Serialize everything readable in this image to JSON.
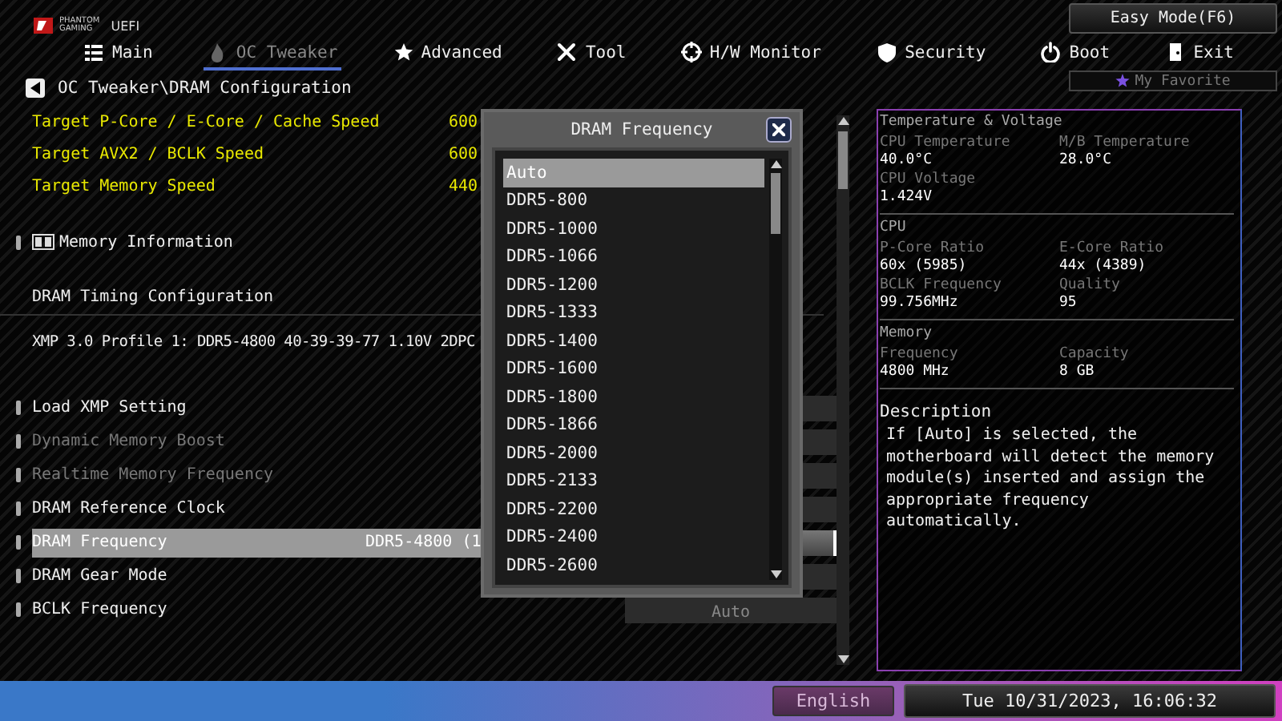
{
  "header": {
    "logo": {
      "lines": [
        "PHANTOM",
        "GAMING"
      ],
      "product": "UEFI"
    },
    "easy_mode_button": "Easy Mode(F6)",
    "tabs": [
      {
        "label": "Main",
        "selected": false
      },
      {
        "label": "OC Tweaker",
        "selected": true
      },
      {
        "label": "Advanced",
        "selected": false
      },
      {
        "label": "Tool",
        "selected": false
      },
      {
        "label": "H/W Monitor",
        "selected": false
      },
      {
        "label": "Security",
        "selected": false
      },
      {
        "label": "Boot",
        "selected": false
      },
      {
        "label": "Exit",
        "selected": false
      }
    ],
    "favorite_button": "My Favorite"
  },
  "breadcrumb": "OC Tweaker\\DRAM Configuration",
  "targets": [
    {
      "label": "Target P-Core / E-Core / Cache Speed",
      "value": "600"
    },
    {
      "label": "Target AVX2 / BCLK Speed",
      "value": "600"
    },
    {
      "label": "Target Memory Speed",
      "value": "440"
    }
  ],
  "items": [
    {
      "kind": "section",
      "label": "Memory Information"
    },
    {
      "kind": "heading",
      "label": "DRAM Timing Configuration"
    },
    {
      "kind": "info",
      "label": "XMP 3.0 Profile 1: DDR5-4800 40-39-39-77 1.10V 2DPC"
    },
    {
      "kind": "setting",
      "label": "Load XMP Setting",
      "disabled": false,
      "selected": false
    },
    {
      "kind": "setting",
      "label": "Dynamic Memory Boost",
      "disabled": true,
      "selected": false
    },
    {
      "kind": "setting",
      "label": "Realtime Memory Frequency",
      "disabled": true,
      "selected": false
    },
    {
      "kind": "setting",
      "label": "DRAM Reference Clock",
      "disabled": false,
      "selected": false
    },
    {
      "kind": "setting",
      "label": "DRAM Frequency",
      "disabled": false,
      "selected": true,
      "value": "DDR5-4800 (1"
    },
    {
      "kind": "setting",
      "label": "DRAM Gear Mode",
      "disabled": false,
      "selected": false
    },
    {
      "kind": "setting",
      "label": "BCLK Frequency",
      "disabled": false,
      "selected": false,
      "option": "Auto"
    }
  ],
  "dialog": {
    "title": "DRAM Frequency",
    "options": [
      {
        "label": "Auto",
        "selected": true
      },
      {
        "label": "DDR5-800",
        "selected": false
      },
      {
        "label": "DDR5-1000",
        "selected": false
      },
      {
        "label": "DDR5-1066",
        "selected": false
      },
      {
        "label": "DDR5-1200",
        "selected": false
      },
      {
        "label": "DDR5-1333",
        "selected": false
      },
      {
        "label": "DDR5-1400",
        "selected": false
      },
      {
        "label": "DDR5-1600",
        "selected": false
      },
      {
        "label": "DDR5-1800",
        "selected": false
      },
      {
        "label": "DDR5-1866",
        "selected": false
      },
      {
        "label": "DDR5-2000",
        "selected": false
      },
      {
        "label": "DDR5-2133",
        "selected": false
      },
      {
        "label": "DDR5-2200",
        "selected": false
      },
      {
        "label": "DDR5-2400",
        "selected": false
      },
      {
        "label": "DDR5-2600",
        "selected": false
      }
    ]
  },
  "sidebar": {
    "sections": [
      {
        "title": "Temperature & Voltage",
        "fields": [
          {
            "label": "CPU Temperature",
            "value": "40.0°C"
          },
          {
            "label": "M/B Temperature",
            "value": "28.0°C"
          },
          {
            "label": "CPU Voltage",
            "value": "1.424V"
          }
        ]
      },
      {
        "title": "CPU",
        "fields": [
          {
            "label": "P-Core Ratio",
            "value": "60x (5985)"
          },
          {
            "label": "E-Core Ratio",
            "value": "44x (4389)"
          },
          {
            "label": "BCLK Frequency",
            "value": "99.756MHz"
          },
          {
            "label": "Quality",
            "value": "95"
          }
        ]
      },
      {
        "title": "Memory",
        "fields": [
          {
            "label": "Frequency",
            "value": "4800 MHz"
          },
          {
            "label": "Capacity",
            "value": "8 GB"
          }
        ]
      }
    ],
    "description": {
      "title": "Description",
      "text": "If [Auto] is selected, the motherboard will detect the memory module(s) inserted and assign the appropriate frequency automatically."
    }
  },
  "status_bar": {
    "language": "English",
    "datetime": "Tue 10/31/2023, 16:06:32"
  }
}
